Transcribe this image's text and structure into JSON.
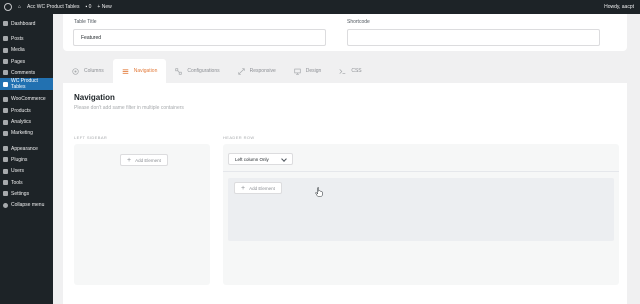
{
  "admin_bar": {
    "site_name": "Acc WC Product Tables",
    "comments_count": "0",
    "new_label": "+ New",
    "howdy": "Howdy, aacpt"
  },
  "sidebar": {
    "items": [
      {
        "label": "Dashboard",
        "icon": "dashboard-icon"
      },
      {
        "label": "Posts",
        "icon": "pin-icon"
      },
      {
        "label": "Media",
        "icon": "media-icon"
      },
      {
        "label": "Pages",
        "icon": "pages-icon"
      },
      {
        "label": "Comments",
        "icon": "comment-icon"
      },
      {
        "label": "WC Product Tables",
        "icon": "table-icon",
        "active": true
      },
      {
        "label": "WooCommerce",
        "icon": "woocommerce-icon"
      },
      {
        "label": "Products",
        "icon": "products-icon"
      },
      {
        "label": "Analytics",
        "icon": "analytics-icon"
      },
      {
        "label": "Marketing",
        "icon": "marketing-icon"
      },
      {
        "label": "Appearance",
        "icon": "appearance-icon"
      },
      {
        "label": "Plugins",
        "icon": "plugins-icon"
      },
      {
        "label": "Users",
        "icon": "users-icon"
      },
      {
        "label": "Tools",
        "icon": "tools-icon"
      },
      {
        "label": "Settings",
        "icon": "settings-icon"
      },
      {
        "label": "Collapse menu",
        "icon": "collapse-icon"
      }
    ]
  },
  "table_title": {
    "label": "Table Title",
    "value": "Featured"
  },
  "shortcode": {
    "label": "Shortcode",
    "value": ""
  },
  "tabs": [
    {
      "label": "Columns",
      "icon": "columns-icon"
    },
    {
      "label": "Navigation",
      "icon": "navigation-icon",
      "active": true
    },
    {
      "label": "Configurations",
      "icon": "configurations-icon"
    },
    {
      "label": "Responsive",
      "icon": "responsive-icon"
    },
    {
      "label": "Design",
      "icon": "design-icon"
    },
    {
      "label": "CSS",
      "icon": "css-icon"
    }
  ],
  "navigation": {
    "title": "Navigation",
    "subtitle": "Please don't add same filter in multiple containers",
    "left_sidebar_label": "LEFT SIDEBAR",
    "header_row_label": "HEADER ROW",
    "add_element_label": "Add Element",
    "layout_select_value": "Left column Only"
  },
  "colors": {
    "accent": "#e37b3b",
    "wp_blue": "#2271b1",
    "sidebar_bg": "#1d2327"
  }
}
